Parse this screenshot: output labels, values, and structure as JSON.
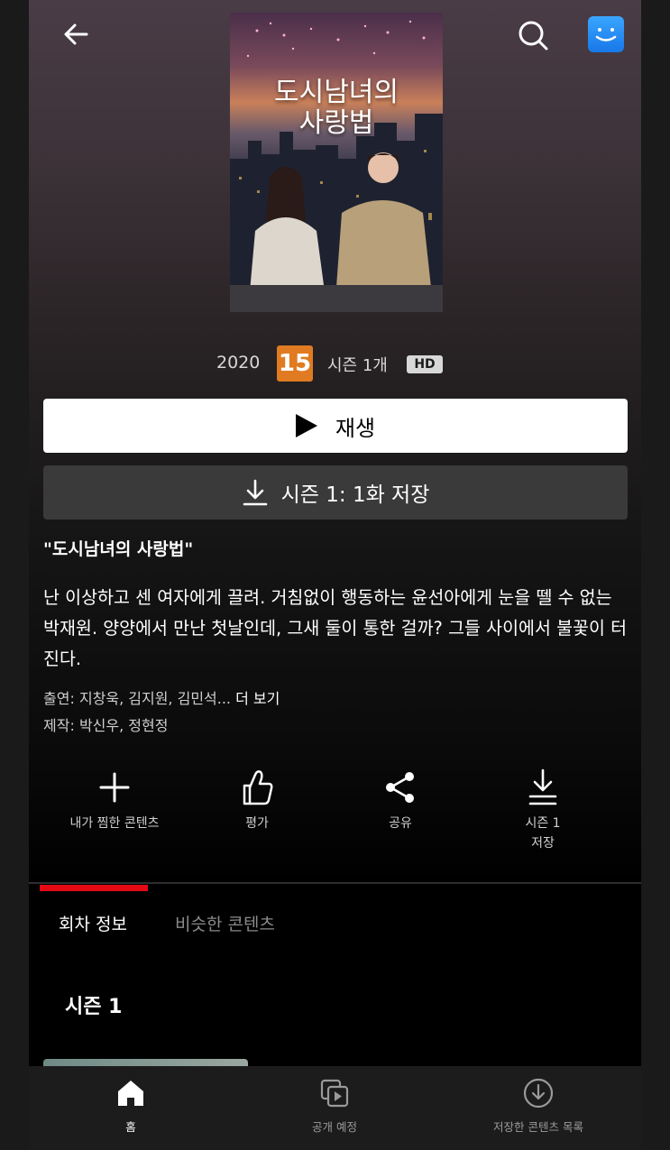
{
  "show": {
    "poster_title_line1": "도시남녀의",
    "poster_title_line2": "사랑법",
    "year": "2020",
    "age_rating": "15",
    "seasons": "시즌 1개",
    "quality": "HD",
    "title": "\"도시남녀의 사랑법\"",
    "description": "난 이상하고 센 여자에게 끌려. 거침없이 행동하는 윤선아에게 눈을 뗄 수 없는 박재원. 양양에서 만난 첫날인데, 그새 둘이 통한 걸까? 그들 사이에서 불꽃이 터진다.",
    "cast_label": "출연:",
    "cast": "지창욱, 김지원, 김민석...",
    "cast_more": "더 보기",
    "creator_label": "제작:",
    "creators": "박신우, 정현정"
  },
  "buttons": {
    "play": "재생",
    "download": "시즌 1: 1화 저장"
  },
  "actions": [
    {
      "label": "내가 찜한 콘텐츠",
      "icon": "plus-icon"
    },
    {
      "label": "평가",
      "icon": "thumbs-up-icon"
    },
    {
      "label": "공유",
      "icon": "share-icon"
    },
    {
      "label": "시즌 1\n저장",
      "icon": "download-icon"
    }
  ],
  "tabs": [
    {
      "label": "회차 정보",
      "active": true
    },
    {
      "label": "비슷한 콘텐츠",
      "active": false
    }
  ],
  "season_selector": "시즌 1",
  "bottom_nav": [
    {
      "label": "홈",
      "icon": "home-icon",
      "active": true
    },
    {
      "label": "공개 예정",
      "icon": "coming-soon-icon",
      "active": false
    },
    {
      "label": "저장한 콘텐츠 목록",
      "icon": "downloads-icon",
      "active": false
    }
  ],
  "colors": {
    "accent": "#e50914",
    "rating_badge": "#e07b22",
    "profile": "#1877e8"
  }
}
